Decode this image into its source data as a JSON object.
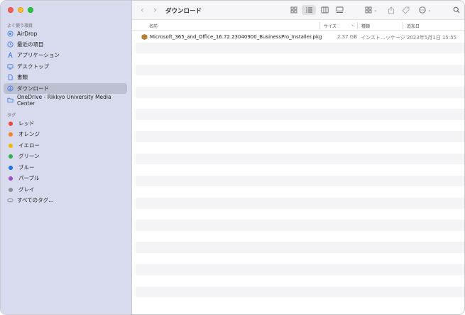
{
  "window": {
    "title": "ダウンロード"
  },
  "sidebar": {
    "favorites_title": "よく使う項目",
    "favorites": [
      {
        "label": "AirDrop",
        "icon": "airdrop-icon"
      },
      {
        "label": "最近の項目",
        "icon": "clock-icon"
      },
      {
        "label": "アプリケーション",
        "icon": "applications-icon"
      },
      {
        "label": "デスクトップ",
        "icon": "desktop-icon"
      },
      {
        "label": "書類",
        "icon": "document-icon"
      },
      {
        "label": "ダウンロード",
        "icon": "download-icon",
        "selected": true
      },
      {
        "label": "OneDrive - Rikkyo University Media Center",
        "icon": "folder-icon"
      }
    ],
    "tags_title": "タグ",
    "tags": [
      {
        "label": "レッド",
        "color": "#f2403b"
      },
      {
        "label": "オレンジ",
        "color": "#f7821b"
      },
      {
        "label": "イエロー",
        "color": "#f5b800"
      },
      {
        "label": "グリーン",
        "color": "#28b446"
      },
      {
        "label": "ブルー",
        "color": "#1b6ff2"
      },
      {
        "label": "パープル",
        "color": "#a349c9"
      },
      {
        "label": "グレイ",
        "color": "#8d8d93"
      },
      {
        "label": "すべてのタグ…",
        "color": ""
      }
    ]
  },
  "columns": {
    "name": "名前",
    "size": "サイズ",
    "kind": "種類",
    "added": "追加日"
  },
  "files": [
    {
      "name": "Microsoft_365_and_Office_16.72.23040900_BusinessPro_Installer.pkg",
      "size": "2.37 GB",
      "kind": "インスト…ッケージ",
      "added": "2023年5月1日 15:55",
      "icon": "package-icon"
    }
  ]
}
